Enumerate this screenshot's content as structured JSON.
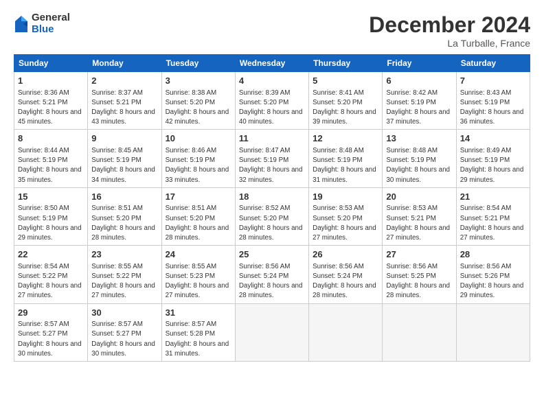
{
  "logo": {
    "general": "General",
    "blue": "Blue"
  },
  "header": {
    "month": "December 2024",
    "location": "La Turballe, France"
  },
  "weekdays": [
    "Sunday",
    "Monday",
    "Tuesday",
    "Wednesday",
    "Thursday",
    "Friday",
    "Saturday"
  ],
  "weeks": [
    [
      {
        "day": "1",
        "sun": "8:36 AM",
        "set": "5:21 PM",
        "daylight": "8 hours and 45 minutes."
      },
      {
        "day": "2",
        "sun": "8:37 AM",
        "set": "5:21 PM",
        "daylight": "8 hours and 43 minutes."
      },
      {
        "day": "3",
        "sun": "8:38 AM",
        "set": "5:20 PM",
        "daylight": "8 hours and 42 minutes."
      },
      {
        "day": "4",
        "sun": "8:39 AM",
        "set": "5:20 PM",
        "daylight": "8 hours and 40 minutes."
      },
      {
        "day": "5",
        "sun": "8:41 AM",
        "set": "5:20 PM",
        "daylight": "8 hours and 39 minutes."
      },
      {
        "day": "6",
        "sun": "8:42 AM",
        "set": "5:19 PM",
        "daylight": "8 hours and 37 minutes."
      },
      {
        "day": "7",
        "sun": "8:43 AM",
        "set": "5:19 PM",
        "daylight": "8 hours and 36 minutes."
      }
    ],
    [
      {
        "day": "8",
        "sun": "8:44 AM",
        "set": "5:19 PM",
        "daylight": "8 hours and 35 minutes."
      },
      {
        "day": "9",
        "sun": "8:45 AM",
        "set": "5:19 PM",
        "daylight": "8 hours and 34 minutes."
      },
      {
        "day": "10",
        "sun": "8:46 AM",
        "set": "5:19 PM",
        "daylight": "8 hours and 33 minutes."
      },
      {
        "day": "11",
        "sun": "8:47 AM",
        "set": "5:19 PM",
        "daylight": "8 hours and 32 minutes."
      },
      {
        "day": "12",
        "sun": "8:48 AM",
        "set": "5:19 PM",
        "daylight": "8 hours and 31 minutes."
      },
      {
        "day": "13",
        "sun": "8:48 AM",
        "set": "5:19 PM",
        "daylight": "8 hours and 30 minutes."
      },
      {
        "day": "14",
        "sun": "8:49 AM",
        "set": "5:19 PM",
        "daylight": "8 hours and 29 minutes."
      }
    ],
    [
      {
        "day": "15",
        "sun": "8:50 AM",
        "set": "5:19 PM",
        "daylight": "8 hours and 29 minutes."
      },
      {
        "day": "16",
        "sun": "8:51 AM",
        "set": "5:20 PM",
        "daylight": "8 hours and 28 minutes."
      },
      {
        "day": "17",
        "sun": "8:51 AM",
        "set": "5:20 PM",
        "daylight": "8 hours and 28 minutes."
      },
      {
        "day": "18",
        "sun": "8:52 AM",
        "set": "5:20 PM",
        "daylight": "8 hours and 28 minutes."
      },
      {
        "day": "19",
        "sun": "8:53 AM",
        "set": "5:20 PM",
        "daylight": "8 hours and 27 minutes."
      },
      {
        "day": "20",
        "sun": "8:53 AM",
        "set": "5:21 PM",
        "daylight": "8 hours and 27 minutes."
      },
      {
        "day": "21",
        "sun": "8:54 AM",
        "set": "5:21 PM",
        "daylight": "8 hours and 27 minutes."
      }
    ],
    [
      {
        "day": "22",
        "sun": "8:54 AM",
        "set": "5:22 PM",
        "daylight": "8 hours and 27 minutes."
      },
      {
        "day": "23",
        "sun": "8:55 AM",
        "set": "5:22 PM",
        "daylight": "8 hours and 27 minutes."
      },
      {
        "day": "24",
        "sun": "8:55 AM",
        "set": "5:23 PM",
        "daylight": "8 hours and 27 minutes."
      },
      {
        "day": "25",
        "sun": "8:56 AM",
        "set": "5:24 PM",
        "daylight": "8 hours and 28 minutes."
      },
      {
        "day": "26",
        "sun": "8:56 AM",
        "set": "5:24 PM",
        "daylight": "8 hours and 28 minutes."
      },
      {
        "day": "27",
        "sun": "8:56 AM",
        "set": "5:25 PM",
        "daylight": "8 hours and 28 minutes."
      },
      {
        "day": "28",
        "sun": "8:56 AM",
        "set": "5:26 PM",
        "daylight": "8 hours and 29 minutes."
      }
    ],
    [
      {
        "day": "29",
        "sun": "8:57 AM",
        "set": "5:27 PM",
        "daylight": "8 hours and 30 minutes."
      },
      {
        "day": "30",
        "sun": "8:57 AM",
        "set": "5:27 PM",
        "daylight": "8 hours and 30 minutes."
      },
      {
        "day": "31",
        "sun": "8:57 AM",
        "set": "5:28 PM",
        "daylight": "8 hours and 31 minutes."
      },
      null,
      null,
      null,
      null
    ]
  ]
}
